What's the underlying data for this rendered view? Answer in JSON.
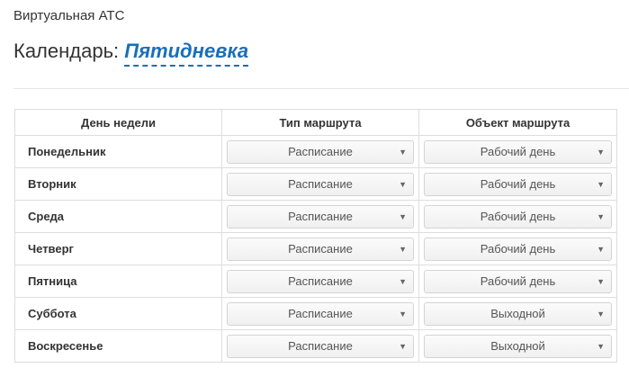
{
  "app": {
    "title": "Виртуальная АТС"
  },
  "header": {
    "prefix": "Календарь:",
    "calendar_name": "Пятидневка"
  },
  "table": {
    "columns": [
      "День недели",
      "Тип маршрута",
      "Объект маршрута"
    ],
    "rows": [
      {
        "day": "Понедельник",
        "route_type": "Расписание",
        "route_object": "Рабочий день"
      },
      {
        "day": "Вторник",
        "route_type": "Расписание",
        "route_object": "Рабочий день"
      },
      {
        "day": "Среда",
        "route_type": "Расписание",
        "route_object": "Рабочий день"
      },
      {
        "day": "Четверг",
        "route_type": "Расписание",
        "route_object": "Рабочий день"
      },
      {
        "day": "Пятница",
        "route_type": "Расписание",
        "route_object": "Рабочий день"
      },
      {
        "day": "Суббота",
        "route_type": "Расписание",
        "route_object": "Выходной"
      },
      {
        "day": "Воскресенье",
        "route_type": "Расписание",
        "route_object": "Выходной"
      }
    ]
  },
  "icons": {
    "dropdown": "caret-down-icon"
  },
  "colors": {
    "accent": "#1a6fb8",
    "border": "#dddddd",
    "text": "#333333"
  }
}
